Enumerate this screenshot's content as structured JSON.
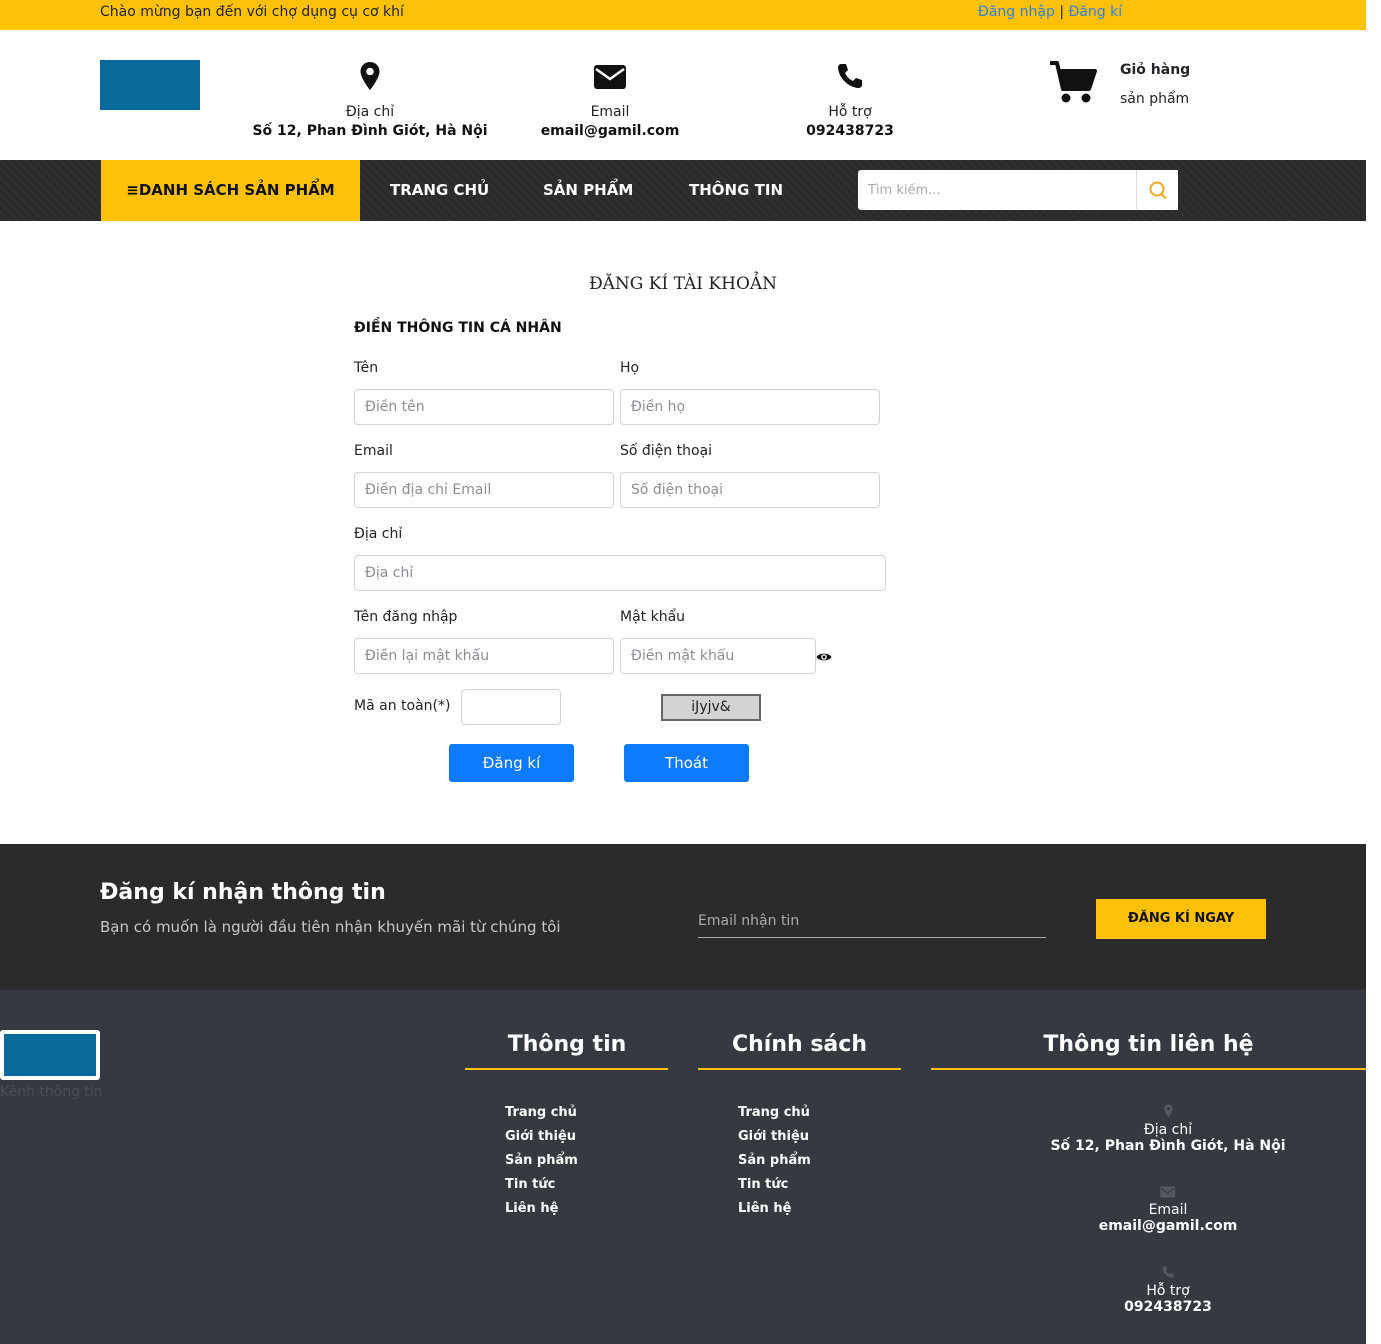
{
  "topbar": {
    "welcome": "Chào mừng bạn đến với chợ dụng cụ cơ khí",
    "login": "Đăng nhập",
    "separator": "|",
    "register": "Đăng kí"
  },
  "header": {
    "address_label": "Địa chỉ",
    "address_value": "Số 12, Phan Đình Giót, Hà Nội",
    "email_label": "Email",
    "email_value": "email@gamil.com",
    "support_label": "Hỗ trợ",
    "support_value": "092438723",
    "cart_label": "Giỏ hàng",
    "cart_sub": "sản phẩm"
  },
  "nav": {
    "categories": "≡DANH SÁCH SẢN PHẨM",
    "home": "TRANG CHỦ",
    "products": "SẢN PHẨM",
    "info": "THÔNG TIN",
    "search_placeholder": "Tìm kiếm..."
  },
  "form": {
    "title": "ĐĂNG KÍ TÀI KHOẢN",
    "section": "ĐIỀN THÔNG TIN CÁ NHÂN",
    "first_name_label": "Tên",
    "first_name_placeholder": "Điền tên",
    "last_name_label": "Họ",
    "last_name_placeholder": "Điền họ",
    "email_label": "Email",
    "email_placeholder": "Điền địa chỉ Email",
    "phone_label": "Số điện thoại",
    "phone_placeholder": "Số điện thoại",
    "address_label": "Địa chỉ",
    "address_placeholder": "Địa chỉ",
    "username_label": "Tên đăng nhập",
    "username_placeholder": "Điền lại mật khẩu",
    "password_label": "Mật khẩu",
    "password_placeholder": "Điền mật khẩu",
    "captcha_label": "Mã an toàn(*)",
    "captcha_code": "iJyjv&",
    "submit": "Đăng kí",
    "exit": "Thoát"
  },
  "newsletter": {
    "heading": "Đăng kí nhận thông tin",
    "subtitle": "Bạn có muốn là người đầu tiên nhận khuyến mãi từ chúng tôi",
    "email_placeholder": "Email nhận tin",
    "button": "ĐĂNG KÍ NGAY"
  },
  "footer": {
    "channel": "Kênh thông tin",
    "col1_title": "Thông tin",
    "col1_links": [
      "Trang chủ",
      "Giới thiệu",
      "Sản phẩm",
      "Tin tức",
      "Liên hệ"
    ],
    "col2_title": "Chính sách",
    "col2_links": [
      "Trang chủ",
      "Giới thiệu",
      "Sản phẩm",
      "Tin tức",
      "Liên hệ"
    ],
    "col3_title": "Thông tin liên hệ",
    "address_label": "Địa chỉ",
    "address_value": "Số 12, Phan Đình Giót, Hà Nội",
    "email_label": "Email",
    "email_value": "email@gamil.com",
    "support_label": "Hỗ trợ",
    "support_value": "092438723"
  },
  "colors": {
    "accent": "#ffc107",
    "logo": "#08699b",
    "button": "#0d7bff",
    "dark": "#2b2b2b",
    "footer": "#343a40"
  }
}
